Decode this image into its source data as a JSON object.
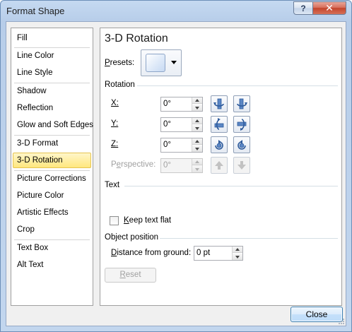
{
  "window": {
    "title": "Format Shape",
    "help_glyph": "?",
    "close_glyph": "✕"
  },
  "nav": {
    "items": [
      {
        "label": "Fill"
      },
      {
        "label": "Line Color"
      },
      {
        "label": "Line Style"
      },
      {
        "label": "Shadow"
      },
      {
        "label": "Reflection"
      },
      {
        "label": "Glow and Soft Edges"
      },
      {
        "label": "3-D Format"
      },
      {
        "label": "3-D Rotation",
        "selected": true
      },
      {
        "label": "Picture Corrections"
      },
      {
        "label": "Picture Color"
      },
      {
        "label": "Artistic Effects"
      },
      {
        "label": "Crop"
      },
      {
        "label": "Text Box"
      },
      {
        "label": "Alt Text"
      }
    ]
  },
  "panel": {
    "title": "3-D Rotation",
    "presets_label": "Presets:",
    "rotation_section": "Rotation",
    "x_label": "X:",
    "x_value": "0°",
    "y_label": "Y:",
    "y_value": "0°",
    "z_label": "Z:",
    "z_value": "0°",
    "perspective_label": "Perspective:",
    "perspective_value": "0°",
    "text_section": "Text",
    "keep_text_flat_label": "Keep text flat",
    "keep_text_flat_checked": false,
    "object_position_section": "Object position",
    "distance_label": "Distance from ground:",
    "distance_value": "0 pt",
    "reset_label": "Reset"
  },
  "footer": {
    "close_label": "Close"
  },
  "colors": {
    "accent_blue": "#3f7fc7",
    "selected_bg": "#ffe77e",
    "title_bar": "#c5d9f1"
  }
}
